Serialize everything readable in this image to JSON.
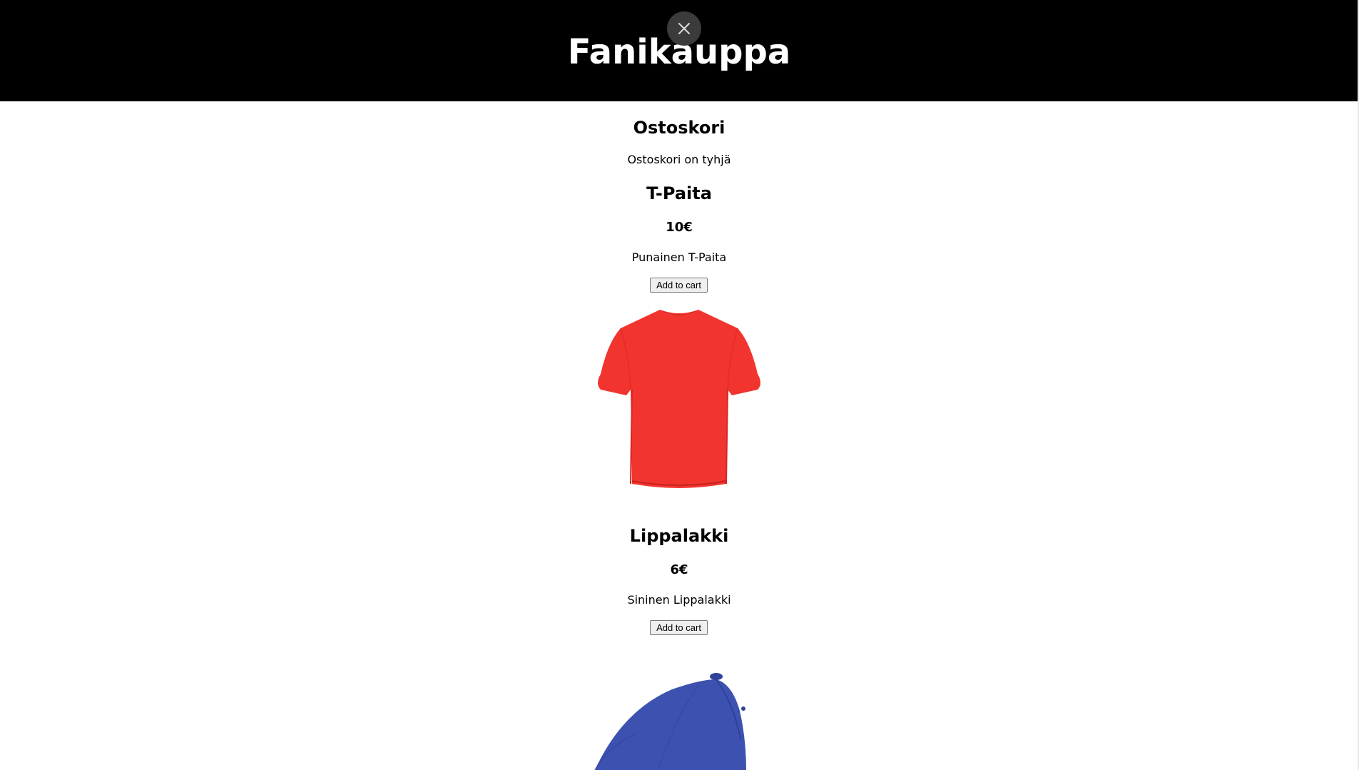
{
  "header": {
    "title": "Fanikauppa",
    "close_icon": "close-icon",
    "background": "#000000"
  },
  "cart": {
    "title": "Ostoskori",
    "empty_message": "Ostoskori on tyhjä"
  },
  "products": [
    {
      "name": "T-Paita",
      "price": "10€",
      "description": "Punainen T-Paita",
      "button_label": "Add to cart",
      "image_icon": "red-tshirt-image",
      "color": "#f2342f"
    },
    {
      "name": "Lippalakki",
      "price": "6€",
      "description": "Sininen Lippalakki",
      "button_label": "Add to cart",
      "image_icon": "blue-cap-image",
      "color": "#3d52b0"
    }
  ]
}
